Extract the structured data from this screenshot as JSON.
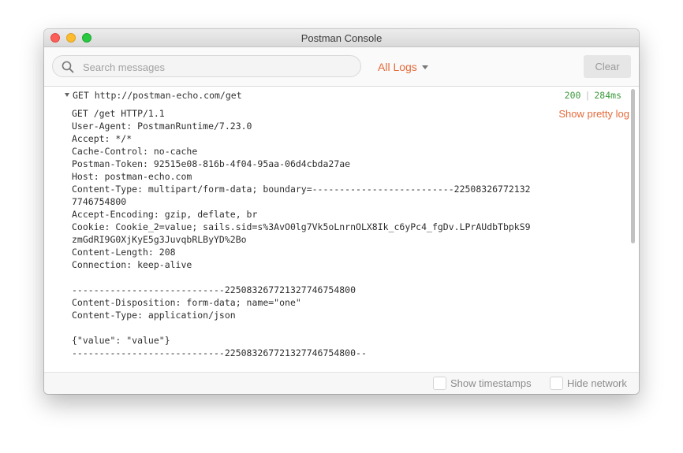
{
  "window": {
    "title": "Postman Console"
  },
  "toolbar": {
    "search_placeholder": "Search messages",
    "logs_filter_label": "All Logs",
    "clear_label": "Clear"
  },
  "request": {
    "summary": "GET http://postman-echo.com/get",
    "status_code": "200",
    "separator": "|",
    "duration": "284ms",
    "pretty_log_label": "Show pretty log",
    "raw_lines": [
      "GET /get HTTP/1.1",
      "User-Agent: PostmanRuntime/7.23.0",
      "Accept: */*",
      "Cache-Control: no-cache",
      "Postman-Token: 92515e08-816b-4f04-95aa-06d4cbda27ae",
      "Host: postman-echo.com",
      "Content-Type: multipart/form-data; boundary=--------------------------22508326772132",
      "7746754800",
      "Accept-Encoding: gzip, deflate, br",
      "Cookie: Cookie_2=value; sails.sid=s%3AvO0lg7Vk5oLnrnOLX8Ik_c6yPc4_fgDv.LPrAUdbTbpkS9",
      "zmGdRI9G0XjKyE5g3JuvqbRLByYD%2Bo",
      "Content-Length: 208",
      "Connection: keep-alive",
      "",
      "----------------------------225083267721327746754800",
      "Content-Disposition: form-data; name=\"one\"",
      "Content-Type: application/json",
      "",
      "{\"value\": \"value\"}",
      "----------------------------225083267721327746754800--"
    ]
  },
  "footer": {
    "show_timestamps_label": "Show timestamps",
    "hide_network_label": "Hide network"
  },
  "colors": {
    "accent": "#e56a3a",
    "status_ok": "#3e9a3e"
  },
  "icons": {
    "search": "search-icon",
    "dropdown": "caret-down-icon",
    "collapse": "disclosure-triangle-icon"
  }
}
